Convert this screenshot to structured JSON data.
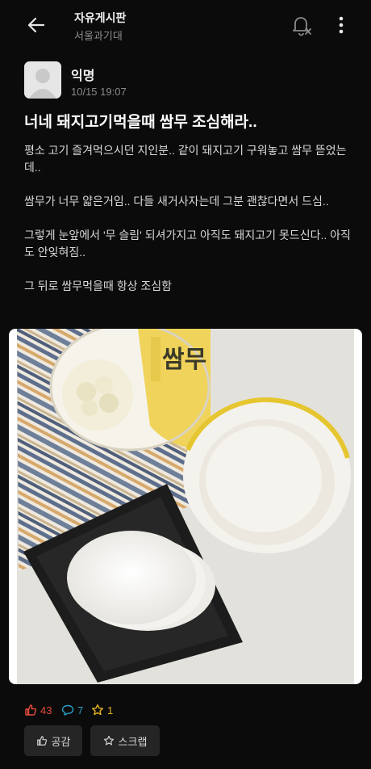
{
  "header": {
    "board_title": "자유게시판",
    "board_subtitle": "서울과기대"
  },
  "post": {
    "author": "익명",
    "time": "10/15 19:07",
    "title": "너네 돼지고기먹을때 쌈무 조심해라..",
    "paragraphs": [
      "평소 고기 즐겨먹으시던 지인분.. 같이 돼지고기 구워놓고 쌈무 뜯었는데..",
      "쌈무가 너무 얇은거임.. 다들 새거사자는데 그분  괜찮다면서 드심..",
      "그렇게 눈앞에서 '무 슬림' 되셔가지고 아직도 돼지고기 못드신다.. 아직도 안잊혀짐..",
      "그 뒤로 쌈무먹을때 항상 조심함"
    ],
    "product_label": "쌈무"
  },
  "stats": {
    "likes": "43",
    "comments": "7",
    "scraps": "1"
  },
  "actions": {
    "like_label": "공감",
    "scrap_label": "스크랩"
  },
  "colors": {
    "like": "#e64b3c",
    "comment": "#2a9fc4",
    "scrap": "#e8b321",
    "background": "#0b0b0b"
  },
  "icons": [
    "back-arrow-icon",
    "bell-off-icon",
    "more-vertical-icon",
    "thumbs-up-icon",
    "speech-bubble-icon",
    "star-icon"
  ]
}
